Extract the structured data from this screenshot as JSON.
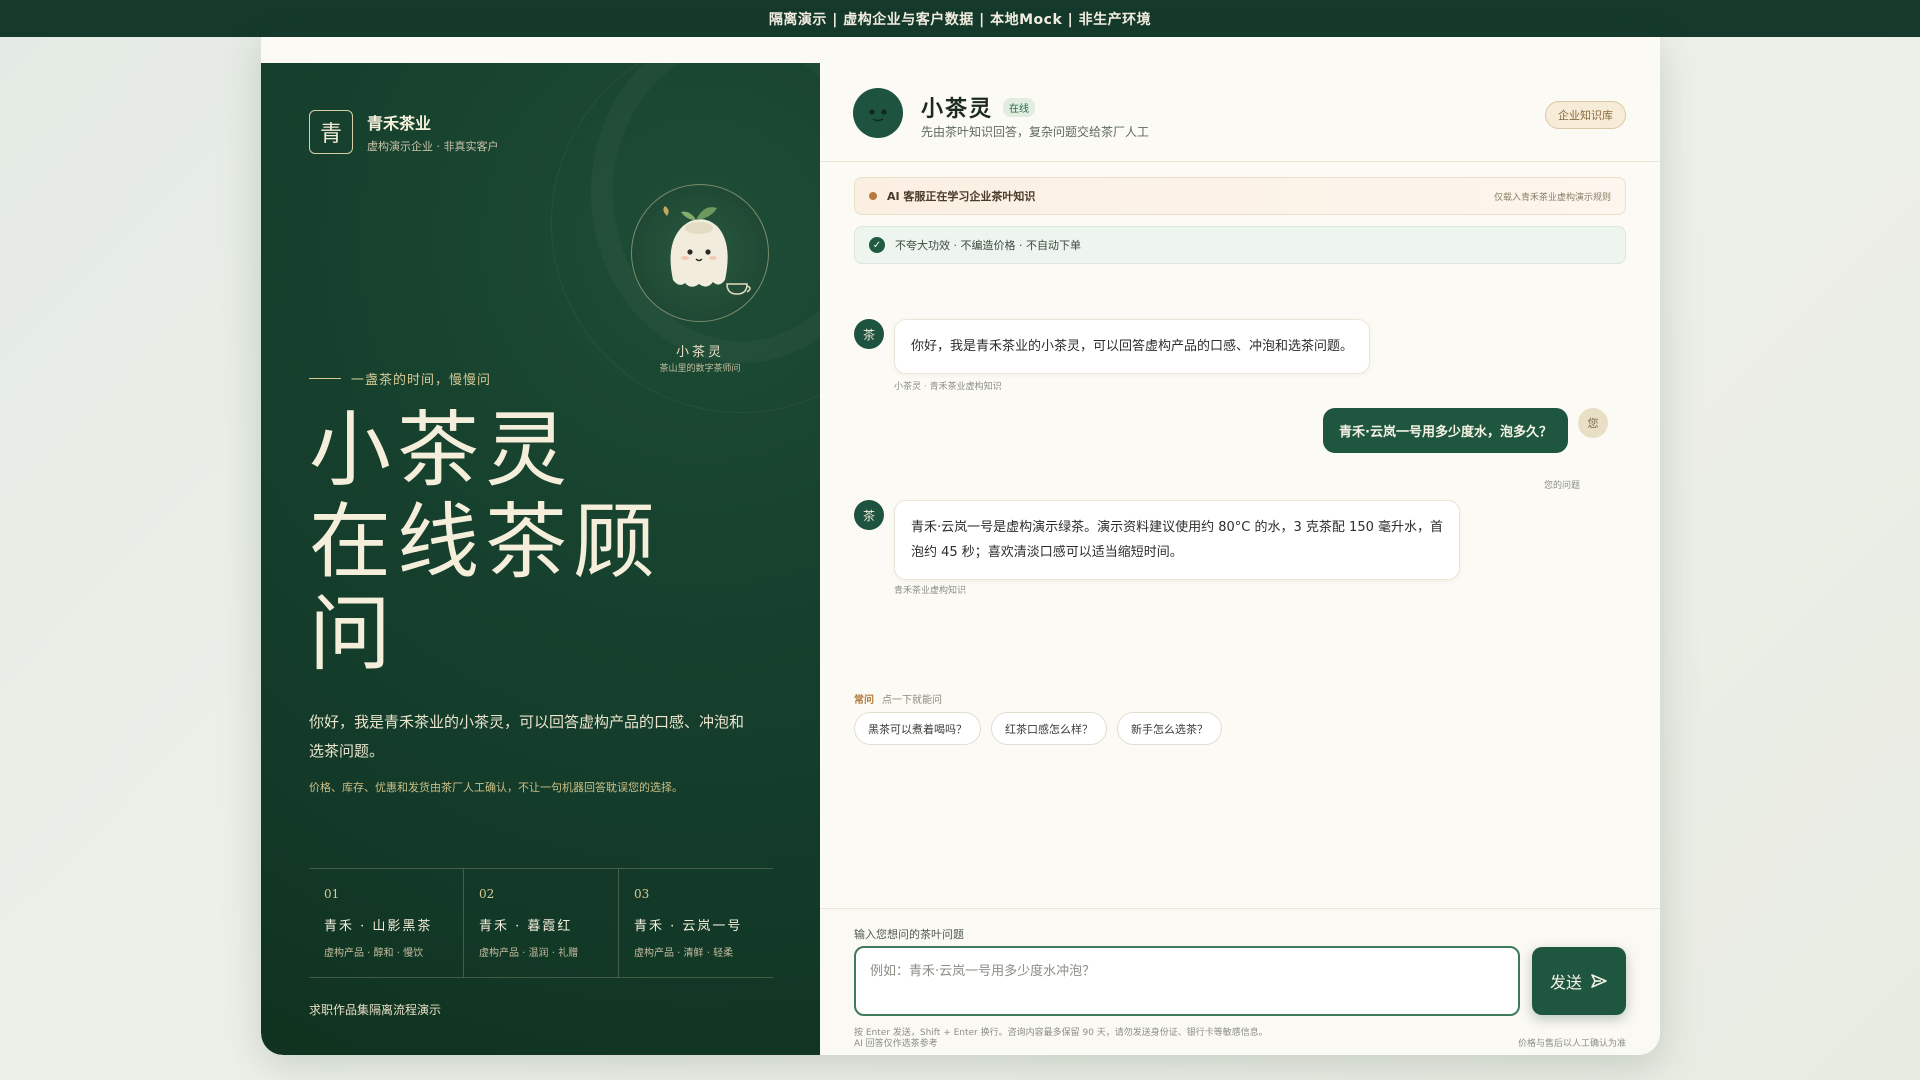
{
  "topbar": {
    "text": "隔离演示 | 虚构企业与客户数据 | 本地Mock | 非生产环境"
  },
  "brand": {
    "logo_char": "青",
    "name": "青禾茶业",
    "subtitle": "虚构演示企业 · 非真实客户"
  },
  "mascot": {
    "name": "小茶灵",
    "subtitle": "茶山里的数字茶师问"
  },
  "hero": {
    "tagline": "一盏茶的时间，慢慢问",
    "title_line1": "小茶灵",
    "title_line2": "在线茶顾",
    "title_line3": "问",
    "description": "你好，我是青禾茶业的小茶灵，可以回答虚构产品的口感、冲泡和选茶问题。",
    "note": "价格、库存、优惠和发货由茶厂人工确认，不让一句机器回答耽误您的选择。"
  },
  "products": [
    {
      "num": "01",
      "name": "青禾 · 山影黑茶",
      "desc": "虚构产品 · 醇和 · 慢饮"
    },
    {
      "num": "02",
      "name": "青禾 · 暮霞红",
      "desc": "虚构产品 · 温润 · 礼赠"
    },
    {
      "num": "03",
      "name": "青禾 · 云岚一号",
      "desc": "虚构产品 · 清鲜 · 轻柔"
    }
  ],
  "left_footer": "求职作品集隔离流程演示",
  "chat": {
    "name": "小茶灵",
    "status": "在线",
    "subtitle": "先由茶叶知识回答，复杂问题交给茶厂人工",
    "kb_button": "企业知识库",
    "learning_text": "AI 客服正在学习企业茶叶知识",
    "learning_right": "仅载入青禾茶业虚构演示规则",
    "promise_text": "不夸大功效 · 不编造价格 · 不自动下单",
    "messages": [
      {
        "role": "bot",
        "avatar": "茶",
        "text": "你好，我是青禾茶业的小茶灵，可以回答虚构产品的口感、冲泡和选茶问题。",
        "meta": "小茶灵 · 青禾茶业虚构知识"
      },
      {
        "role": "user",
        "avatar": "您",
        "text": "青禾·云岚一号用多少度水，泡多久？",
        "meta": "您的问题"
      },
      {
        "role": "bot",
        "avatar": "茶",
        "text_line1": "青禾·云岚一号是虚构演示绿茶。演示资料建议使用约 80°C 的水，3 克茶配 150 毫升水，首",
        "text_line2": "泡约 45 秒；喜欢清淡口感可以适当缩短时间。",
        "meta": "青禾茶业虚构知识"
      }
    ],
    "faq_tag": "常问",
    "faq_label": "点一下就能问",
    "faq": [
      "黑茶可以煮着喝吗？",
      "红茶口感怎么样？",
      "新手怎么选茶？"
    ],
    "input_label": "输入您想问的茶叶问题",
    "input_placeholder": "例如：青禾·云岚一号用多少度水冲泡？",
    "send_label": "发送",
    "input_hint": "按 Enter 发送，Shift + Enter 换行。咨询内容最多保留 90 天，请勿发送身份证、银行卡等敏感信息。",
    "footer_left": "AI 回答仅作选茶参考",
    "footer_right": "价格与售后以人工确认为准"
  },
  "colors": {
    "dark_green": "#153a2c",
    "accent_green": "#1f5640",
    "gold": "#d7c995",
    "cream": "#fcfaf4"
  }
}
